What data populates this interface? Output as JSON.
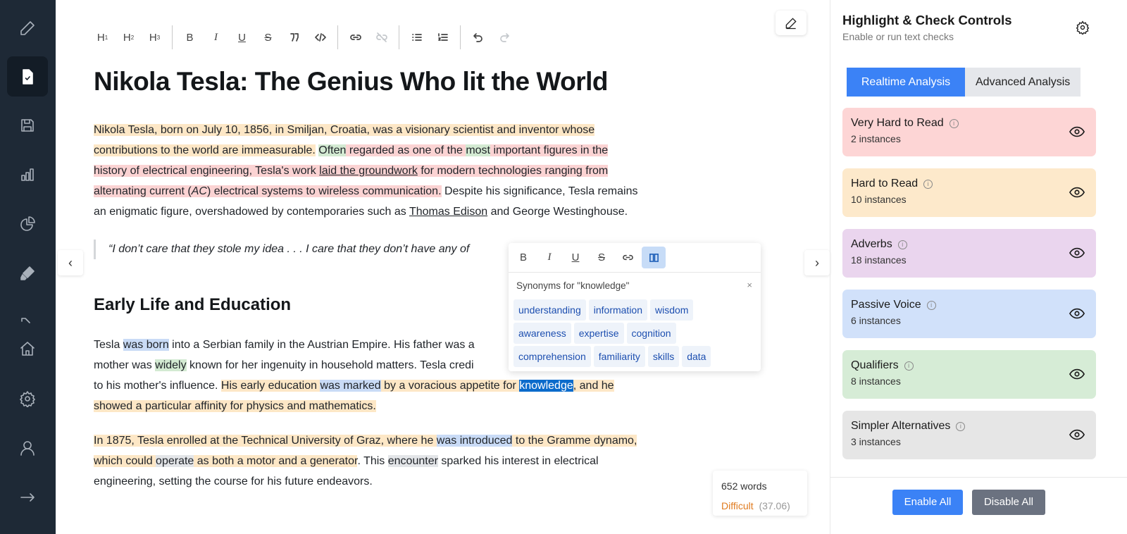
{
  "sidebar": {
    "items": [
      "pencil-icon",
      "document-check-icon",
      "save-icon",
      "bar-chart-icon",
      "pie-chart-icon",
      "highlighter-icon",
      "partial-icon",
      "home-icon",
      "settings-icon",
      "user-icon",
      "arrow-right-icon"
    ]
  },
  "toolbar": {
    "h1": "H",
    "h2": "H",
    "h3": "H",
    "n1": "1",
    "n2": "2",
    "n3": "3",
    "bold": "B",
    "italic": "I",
    "underline": "U",
    "strike": "S"
  },
  "doc": {
    "title": "Nikola Tesla: The Genius Who lit the World",
    "p1": [
      [
        {
          "t": "Nikola Tesla, born on July 10, 1856, in Smiljan, Croatia, was a visionary scientist and inventor whose ",
          "c": "hl-orange"
        }
      ],
      [
        {
          "t": "contributions to the world are immeasurable.",
          "c": "hl-orange"
        },
        {
          "t": " ",
          "c": ""
        },
        {
          "t": "Often",
          "c": "hl-green"
        },
        {
          "t": " regarded as one of the ",
          "c": "hl-red"
        },
        {
          "t": "most",
          "c": "hl-green"
        },
        {
          "t": " important figures in the ",
          "c": "hl-red"
        }
      ],
      [
        {
          "t": "history of electrical engineering, Tesla's work ",
          "c": "hl-red"
        },
        {
          "t": "laid the groundwork",
          "c": "hl-red u"
        },
        {
          "t": " for modern technologies ranging from ",
          "c": "hl-red"
        }
      ],
      [
        {
          "t": "alternating current (",
          "c": "hl-red"
        },
        {
          "t": "AC",
          "c": "hl-red i"
        },
        {
          "t": ") electrical systems to wireless communication.",
          "c": "hl-red"
        },
        {
          "t": " Despite his significance, Tesla remains",
          "c": ""
        }
      ],
      [
        {
          "t": "an enigmatic figure, overshadowed by contemporaries such as ",
          "c": ""
        },
        {
          "t": "Thomas Edison",
          "c": "u"
        },
        {
          "t": " and George Westinghouse.",
          "c": ""
        }
      ]
    ],
    "quote": "“I don’t care that they stole my idea . . . I care that they don’t have any of",
    "h2": "Early Life and Education",
    "p2": [
      [
        {
          "t": "Tesla ",
          "c": ""
        },
        {
          "t": "was born",
          "c": "hl-blue"
        },
        {
          "t": " into a Serbian family in the Austrian Empire. His father was a",
          "c": ""
        }
      ],
      [
        {
          "t": "mother was ",
          "c": ""
        },
        {
          "t": "widely",
          "c": "hl-green"
        },
        {
          "t": " known for her ingenuity in household matters. Tesla credi",
          "c": ""
        }
      ],
      [
        {
          "t": "to his mother's influence. ",
          "c": ""
        },
        {
          "t": "His early education ",
          "c": "hl-orange"
        },
        {
          "t": "was marked",
          "c": "hl-blue"
        },
        {
          "t": " by a voracious appetite for ",
          "c": "hl-orange"
        },
        {
          "t": "knowledge",
          "c": "hl-sel"
        },
        {
          "t": ", and he",
          "c": "hl-orange"
        }
      ],
      [
        {
          "t": "showed a particular affinity for physics and mathematics.",
          "c": "hl-orange"
        }
      ]
    ],
    "p3": [
      [
        {
          "t": "In 1875, Tesla enrolled at the Technical University of Graz, where he ",
          "c": "hl-orange"
        },
        {
          "t": "was introduced",
          "c": "hl-blue"
        },
        {
          "t": " to the Gramme dynamo,",
          "c": "hl-orange"
        }
      ],
      [
        {
          "t": "which could ",
          "c": "hl-orange"
        },
        {
          "t": "operate",
          "c": "hl-grey"
        },
        {
          "t": " as both a motor and a generator",
          "c": "hl-orange"
        },
        {
          "t": ". This ",
          "c": ""
        },
        {
          "t": "encounter",
          "c": "hl-grey"
        },
        {
          "t": " sparked his interest in electrical",
          "c": ""
        }
      ],
      [
        {
          "t": "engineering, setting the course for his future endeavors.",
          "c": ""
        }
      ]
    ]
  },
  "popup": {
    "bold": "B",
    "italic": "I",
    "underline": "U",
    "strike": "S",
    "header": "Synonyms for \"knowledge\"",
    "close": "×",
    "synonyms": [
      "understanding",
      "information",
      "wisdom",
      "awareness",
      "expertise",
      "cognition",
      "comprehension",
      "familiarity",
      "skills",
      "data"
    ]
  },
  "stats": {
    "words": "652 words",
    "level": "Difficult",
    "score": "(37.06)",
    "level_color": "#e07b1f"
  },
  "panel": {
    "title": "Highlight & Check Controls",
    "subtitle": "Enable or run text checks",
    "tabs": [
      "Realtime Analysis",
      "Advanced Analysis"
    ],
    "cards": [
      {
        "label": "Very Hard to Read",
        "count": "2 instances",
        "color": "#fdd5d5"
      },
      {
        "label": "Hard to Read",
        "count": "10 instances",
        "color": "#fde9cb"
      },
      {
        "label": "Adverbs",
        "count": "18 instances",
        "color": "#ead5ee"
      },
      {
        "label": "Passive Voice",
        "count": "6 instances",
        "color": "#d1e1fa"
      },
      {
        "label": "Qualifiers",
        "count": "8 instances",
        "color": "#d6ecd6"
      },
      {
        "label": "Simpler Alternatives",
        "count": "3 instances",
        "color": "#e6e6e6"
      }
    ],
    "enable_all": "Enable All",
    "disable_all": "Disable All",
    "accent": "#3b82f6"
  }
}
